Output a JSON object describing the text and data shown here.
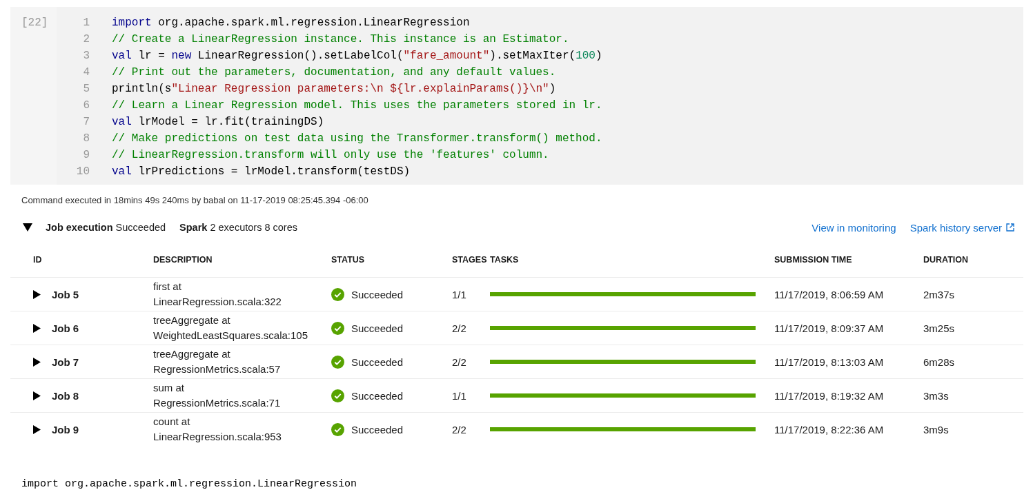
{
  "cell": {
    "execution_count": "[22]",
    "lines": [
      {
        "number": "1",
        "tokens": [
          {
            "kind": "keyword",
            "text": "import"
          },
          {
            "kind": "plain",
            "text": " org.apache.spark.ml.regression.LinearRegression"
          }
        ]
      },
      {
        "number": "2",
        "tokens": [
          {
            "kind": "comment",
            "text": "// Create a LinearRegression instance. This instance is an Estimator."
          }
        ]
      },
      {
        "number": "3",
        "tokens": [
          {
            "kind": "keyword",
            "text": "val"
          },
          {
            "kind": "plain",
            "text": " lr = "
          },
          {
            "kind": "keyword",
            "text": "new"
          },
          {
            "kind": "plain",
            "text": " LinearRegression().setLabelCol("
          },
          {
            "kind": "string",
            "text": "\"fare_amount\""
          },
          {
            "kind": "plain",
            "text": ").setMaxIter("
          },
          {
            "kind": "number",
            "text": "100"
          },
          {
            "kind": "plain",
            "text": ")"
          }
        ]
      },
      {
        "number": "4",
        "tokens": [
          {
            "kind": "comment",
            "text": "// Print out the parameters, documentation, and any default values."
          }
        ]
      },
      {
        "number": "5",
        "tokens": [
          {
            "kind": "plain",
            "text": "println(s"
          },
          {
            "kind": "string",
            "text": "\"Linear Regression parameters:\\n ${lr.explainParams()}\\n\""
          },
          {
            "kind": "plain",
            "text": ")"
          }
        ]
      },
      {
        "number": "6",
        "tokens": [
          {
            "kind": "comment",
            "text": "// Learn a Linear Regression model. This uses the parameters stored in lr."
          }
        ]
      },
      {
        "number": "7",
        "tokens": [
          {
            "kind": "keyword",
            "text": "val"
          },
          {
            "kind": "plain",
            "text": " lrModel = lr.fit(trainingDS)"
          }
        ]
      },
      {
        "number": "8",
        "tokens": [
          {
            "kind": "comment",
            "text": "// Make predictions on test data using the Transformer.transform() method."
          }
        ]
      },
      {
        "number": "9",
        "tokens": [
          {
            "kind": "comment",
            "text": "// LinearRegression.transform will only use the 'features' column."
          }
        ]
      },
      {
        "number": "10",
        "tokens": [
          {
            "kind": "keyword",
            "text": "val"
          },
          {
            "kind": "plain",
            "text": " lrPredictions = lrModel.transform(testDS)"
          }
        ]
      }
    ]
  },
  "command_info": "Command executed in 18mins 49s 240ms by babal on 11-17-2019 08:25:45.394 -06:00",
  "job_summary": {
    "expanded": true,
    "execution": "**Job execution** Succeeded",
    "resources": "**Spark** 2 executors 8 cores",
    "links": [
      {
        "label": "View in monitoring",
        "external": false
      },
      {
        "label": "Spark history server",
        "external": true
      }
    ]
  },
  "table": {
    "columns": [
      "ID",
      "DESCRIPTION",
      "STATUS",
      "STAGES",
      "TASKS",
      "SUBMISSION TIME",
      "DURATION"
    ],
    "rows": [
      {
        "expanded": false,
        "id": "Job 5",
        "description": "first at\nLinearRegression.scala:322",
        "status": {
          "kind": "success",
          "label": "Succeeded"
        },
        "stages": "1/1",
        "tasks": {
          "level": 1
        },
        "submitted": "11/17/2019, 8:06:59 AM",
        "duration": "2m37s"
      },
      {
        "expanded": false,
        "id": "Job 6",
        "description": "treeAggregate at\nWeightedLeastSquares.scala:105",
        "status": {
          "kind": "success",
          "label": "Succeeded"
        },
        "stages": "2/2",
        "tasks": {
          "level": 1
        },
        "submitted": "11/17/2019, 8:09:37 AM",
        "duration": "3m25s"
      },
      {
        "expanded": false,
        "id": "Job 7",
        "description": "treeAggregate at\nRegressionMetrics.scala:57",
        "status": {
          "kind": "success",
          "label": "Succeeded"
        },
        "stages": "2/2",
        "tasks": {
          "level": 1
        },
        "submitted": "11/17/2019, 8:13:03 AM",
        "duration": "6m28s"
      },
      {
        "expanded": false,
        "id": "Job 8",
        "description": "sum at\nRegressionMetrics.scala:71",
        "status": {
          "kind": "success",
          "label": "Succeeded"
        },
        "stages": "1/1",
        "tasks": {
          "level": 1
        },
        "submitted": "11/17/2019, 8:19:32 AM",
        "duration": "3m3s"
      },
      {
        "expanded": false,
        "id": "Job 9",
        "description": "count at\nLinearRegression.scala:953",
        "status": {
          "kind": "success",
          "label": "Succeeded"
        },
        "stages": "2/2",
        "tasks": {
          "level": 1
        },
        "submitted": "11/17/2019, 8:22:36 AM",
        "duration": "3m9s"
      }
    ]
  },
  "output": "import org.apache.spark.ml.regression.LinearRegression"
}
